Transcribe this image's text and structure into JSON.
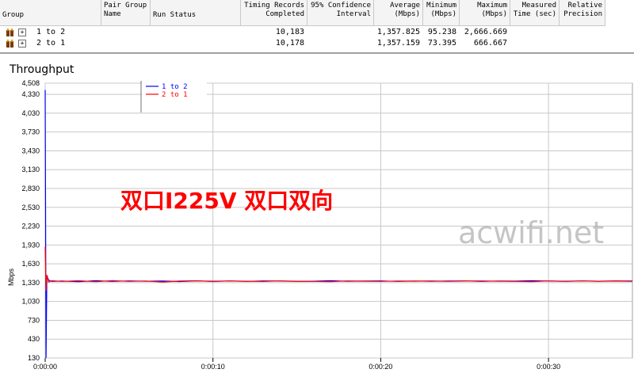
{
  "table": {
    "headers": [
      {
        "key": "group",
        "label": "Group"
      },
      {
        "key": "pair",
        "label": "Pair Group Name"
      },
      {
        "key": "status",
        "label": "Run Status"
      },
      {
        "key": "records",
        "label": "Timing Records Completed"
      },
      {
        "key": "ci",
        "label": "95% Confidence Interval"
      },
      {
        "key": "avg",
        "label": "Average (Mbps)"
      },
      {
        "key": "min",
        "label": "Minimum (Mbps)"
      },
      {
        "key": "max",
        "label": "Maximum (Mbps)"
      },
      {
        "key": "time",
        "label": "Measured Time (sec)"
      },
      {
        "key": "prec",
        "label": "Relative Precision"
      }
    ],
    "rows": [
      {
        "expand": "+",
        "group": "1 to 2",
        "records": "10,183",
        "avg": "1,357.825",
        "min": "95.238",
        "max": "2,666.669"
      },
      {
        "expand": "+",
        "group": "2 to 1",
        "records": "10,178",
        "avg": "1,357.159",
        "min": "73.395",
        "max": "666.667"
      }
    ]
  },
  "title": "Throughput",
  "annotation": "双口I225V 双口双向",
  "watermark": "acwifi.net",
  "colors": {
    "series1": "#0000ff",
    "series2": "#ff0000",
    "grid": "#c8c8c8"
  },
  "chart_data": {
    "type": "line",
    "ylabel": "Mbps",
    "ylim": [
      130,
      4508
    ],
    "yticks": [
      "4,508",
      "4,330",
      "4,030",
      "3,730",
      "3,430",
      "3,130",
      "2,830",
      "2,530",
      "2,230",
      "1,930",
      "1,630",
      "1,330",
      "1,030",
      "730",
      "430",
      "130"
    ],
    "ytick_values": [
      4508,
      4330,
      4030,
      3730,
      3430,
      3130,
      2830,
      2530,
      2230,
      1930,
      1630,
      1330,
      1030,
      730,
      430,
      130
    ],
    "xticks": [
      "0:00:00",
      "0:00:10",
      "0:00:20",
      "0:00:30"
    ],
    "xtick_values": [
      0,
      10,
      20,
      30
    ],
    "xlim": [
      0,
      35
    ],
    "legend": "top-left",
    "series": [
      {
        "name": "1 to 2",
        "color": "#0000ff",
        "x": [
          0,
          0.05,
          0.1,
          0.2,
          0.4,
          1,
          2,
          3,
          4,
          5,
          6,
          7,
          8,
          9,
          10,
          11,
          12,
          13,
          14,
          15,
          16,
          17,
          18,
          19,
          20,
          21,
          22,
          23,
          24,
          25,
          26,
          27,
          28,
          29,
          30,
          31,
          32,
          33,
          34,
          35
        ],
        "y": [
          4400,
          130,
          1450,
          1370,
          1350,
          1355,
          1345,
          1360,
          1350,
          1358,
          1352,
          1355,
          1348,
          1357,
          1352,
          1356,
          1350,
          1358,
          1355,
          1350,
          1353,
          1360,
          1352,
          1355,
          1358,
          1350,
          1356,
          1353,
          1355,
          1357,
          1350,
          1356,
          1354,
          1360,
          1355,
          1352,
          1357,
          1353,
          1358,
          1355
        ]
      },
      {
        "name": "2 to 1",
        "color": "#ff0000",
        "x": [
          0,
          0.05,
          0.1,
          0.2,
          0.4,
          1,
          2,
          3,
          4,
          5,
          6,
          7,
          8,
          9,
          10,
          11,
          12,
          13,
          14,
          15,
          16,
          17,
          18,
          19,
          20,
          21,
          22,
          23,
          24,
          25,
          26,
          27,
          28,
          29,
          30,
          31,
          32,
          33,
          34,
          35
        ],
        "y": [
          1900,
          1200,
          1450,
          1340,
          1360,
          1350,
          1360,
          1345,
          1362,
          1350,
          1356,
          1340,
          1355,
          1360,
          1348,
          1357,
          1352,
          1349,
          1358,
          1353,
          1350,
          1345,
          1358,
          1352,
          1350,
          1356,
          1352,
          1358,
          1350,
          1355,
          1357,
          1352,
          1350,
          1346,
          1358,
          1350,
          1356,
          1352,
          1355,
          1350
        ]
      }
    ]
  }
}
